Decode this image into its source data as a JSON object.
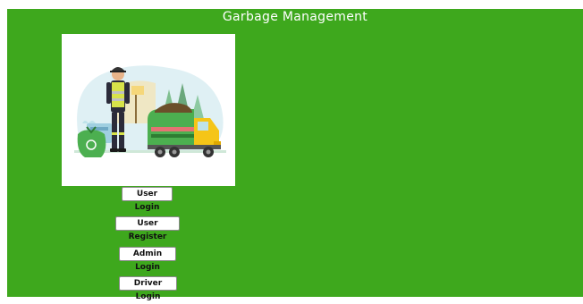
{
  "header": {
    "title": "Garbage Management"
  },
  "hero": {
    "icon": "garbage-worker-truck-illustration"
  },
  "buttons": {
    "user_login": "User Login",
    "user_register": "User Register",
    "admin_login": "Admin Login",
    "driver_login": "Driver Login"
  },
  "colors": {
    "background": "#3ea81d",
    "title_text": "#ffffff",
    "button_background": "#ffffff"
  }
}
